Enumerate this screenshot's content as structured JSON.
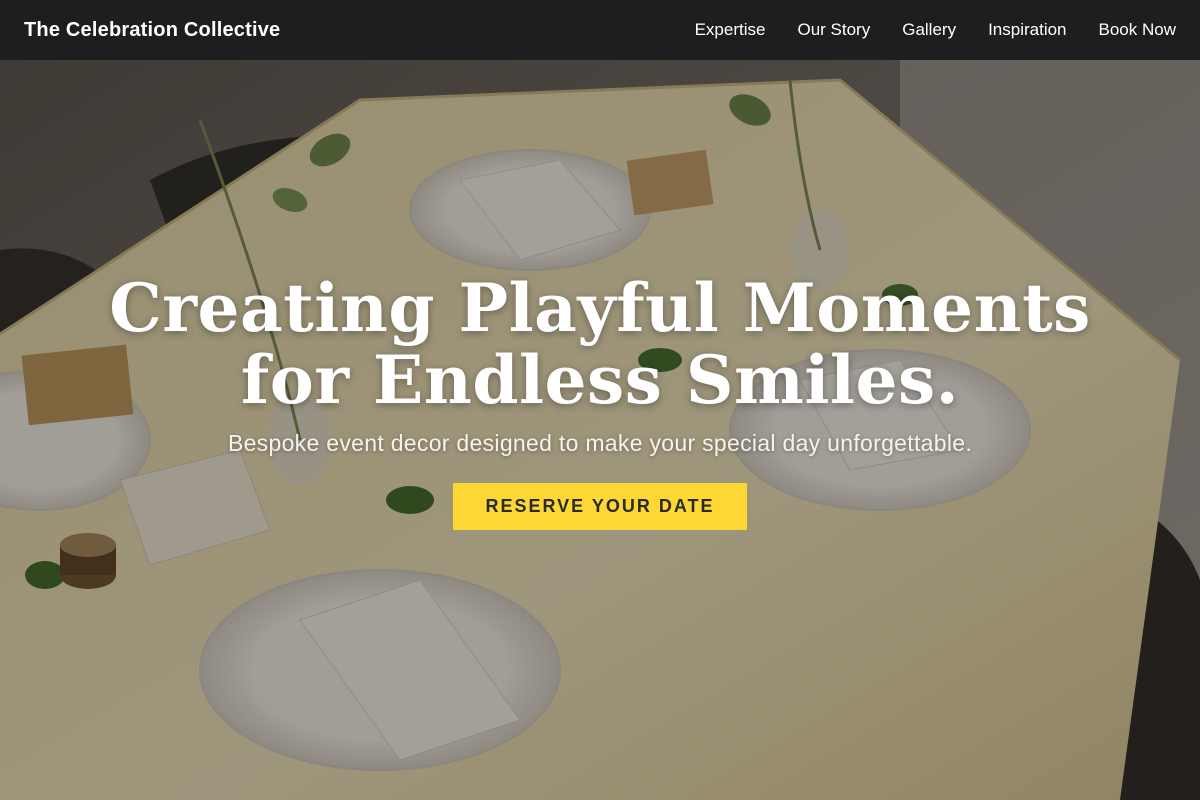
{
  "nav": {
    "brand": "The Celebration Collective",
    "links": [
      {
        "label": "Expertise"
      },
      {
        "label": "Our Story"
      },
      {
        "label": "Gallery"
      },
      {
        "label": "Inspiration"
      },
      {
        "label": "Book Now"
      }
    ]
  },
  "hero": {
    "heading_line1": "Creating Playful Moments",
    "heading_line2": "for Endless Smiles.",
    "subheading": "Bespoke event decor designed to make your special day unforgettable.",
    "cta_label": "RESERVE YOUR DATE",
    "background_image": "banquet-table-place-settings-photo"
  },
  "colors": {
    "nav_background": "#1e1e1e",
    "cta_background": "#fdd835",
    "cta_text": "#2a2a2a",
    "heading_text": "#ffffff"
  }
}
